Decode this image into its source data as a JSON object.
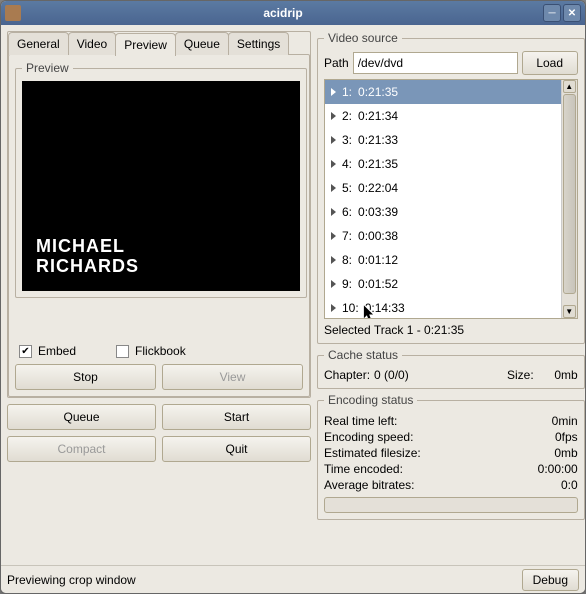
{
  "window": {
    "title": "acidrip"
  },
  "tabs": [
    "General",
    "Video",
    "Preview",
    "Queue",
    "Settings"
  ],
  "preview": {
    "legend": "Preview",
    "overlay_line1": "MICHAEL",
    "overlay_line2": "RICHARDS",
    "embed_label": "Embed",
    "embed_checked": true,
    "flickbook_label": "Flickbook",
    "flickbook_checked": false,
    "stop_label": "Stop",
    "view_label": "View"
  },
  "bottom": {
    "queue_label": "Queue",
    "start_label": "Start",
    "compact_label": "Compact",
    "quit_label": "Quit"
  },
  "source": {
    "legend": "Video source",
    "path_label": "Path",
    "path_value": "/dev/dvd",
    "load_label": "Load",
    "tracks": [
      {
        "idx": "1:",
        "dur": "0:21:35"
      },
      {
        "idx": "2:",
        "dur": "0:21:34"
      },
      {
        "idx": "3:",
        "dur": "0:21:33"
      },
      {
        "idx": "4:",
        "dur": "0:21:35"
      },
      {
        "idx": "5:",
        "dur": "0:22:04"
      },
      {
        "idx": "6:",
        "dur": "0:03:39"
      },
      {
        "idx": "7:",
        "dur": "0:00:38"
      },
      {
        "idx": "8:",
        "dur": "0:01:12"
      },
      {
        "idx": "9:",
        "dur": "0:01:52"
      },
      {
        "idx": "10:",
        "dur": "0:14:33"
      }
    ],
    "selected_label": "Selected Track 1 - 0:21:35"
  },
  "cache": {
    "legend": "Cache status",
    "chapter_label": "Chapter:",
    "chapter_value": "0 (0/0)",
    "size_label": "Size:",
    "size_value": "0mb"
  },
  "encoding": {
    "legend": "Encoding status",
    "rows": [
      {
        "label": "Real time left:",
        "value": "0min"
      },
      {
        "label": "Encoding speed:",
        "value": "0fps"
      },
      {
        "label": "Estimated filesize:",
        "value": "0mb"
      },
      {
        "label": "Time encoded:",
        "value": "0:00:00"
      },
      {
        "label": "Average bitrates:",
        "value": "0:0"
      }
    ]
  },
  "status": {
    "text": "Previewing crop window",
    "debug_label": "Debug"
  }
}
